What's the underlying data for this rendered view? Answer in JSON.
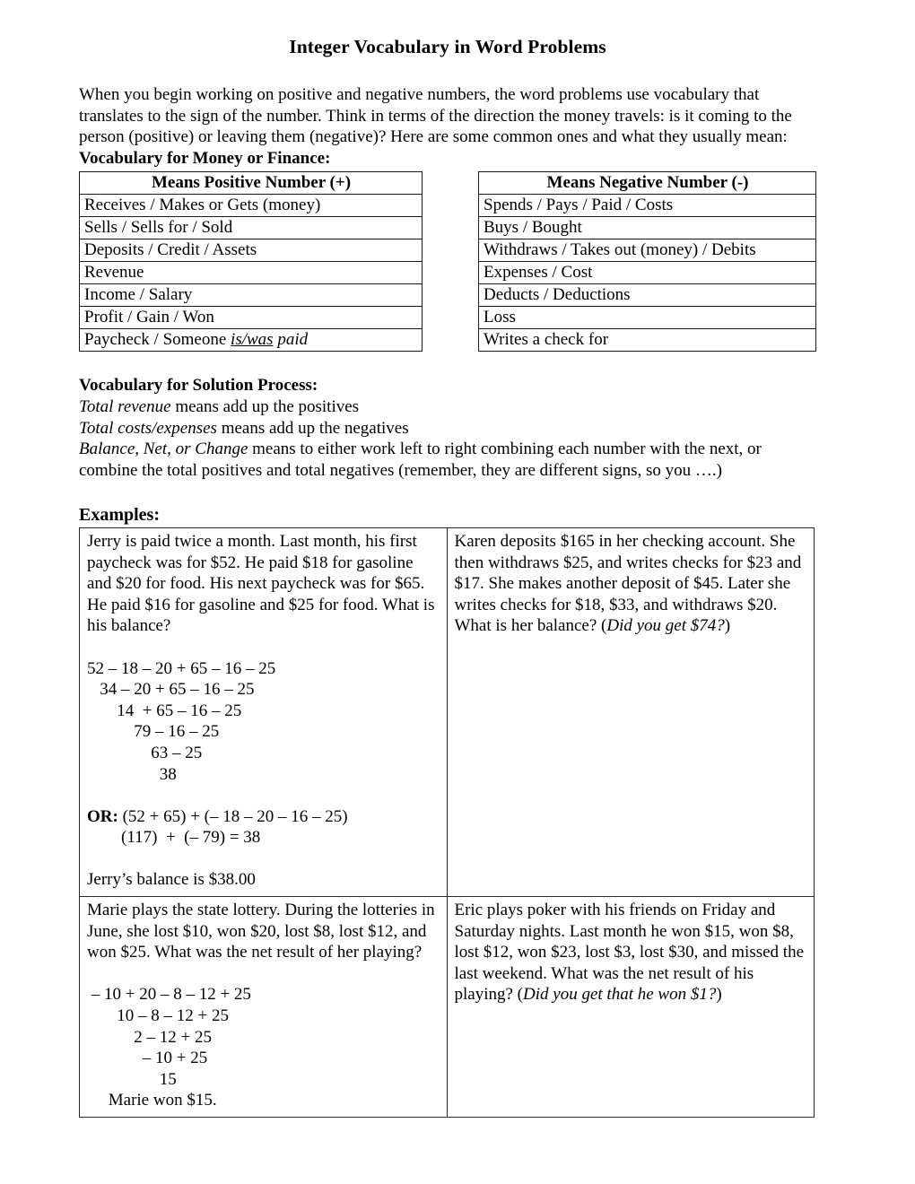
{
  "document": {
    "title": "Integer Vocabulary in Word Problems",
    "intro": "When you begin working on positive and negative numbers, the word problems use vocabulary that translates to the sign of the number.  Think in terms of the direction the money travels: is it coming to the person (positive) or leaving them (negative)?  Here are some common ones and what they usually mean:"
  },
  "money_vocab": {
    "heading": "Vocabulary for Money or Finance:",
    "positive_header": "Means Positive Number (+)",
    "negative_header": "Means Negative Number (-)",
    "positive_rows": [
      "Receives / Makes or Gets (money)",
      "Sells / Sells for / Sold",
      "Deposits / Credit / Assets",
      "Revenue",
      "Income / Salary",
      "Profit / Gain / Won",
      "Paycheck / Someone is/was paid"
    ],
    "positive_row_last": {
      "plain": "Paycheck / Someone ",
      "italic_underline": "is/was",
      "italic": " paid"
    },
    "negative_rows": [
      "Spends / Pays / Paid / Costs",
      "Buys / Bought",
      "Withdraws / Takes out (money) / Debits",
      "Expenses / Cost",
      "Deducts / Deductions",
      "Loss",
      "Writes a check for"
    ]
  },
  "solution_vocab": {
    "heading": "Vocabulary for Solution Process:",
    "line1_italic": "Total revenue",
    "line1_rest": " means add up the positives",
    "line2_italic": "Total costs/expenses",
    "line2_rest": " means add up the negatives",
    "line3_italic": "Balance, Net, or Change",
    "line3_rest": " means to either work left to right combining each number with the next, or combine the total positives and total negatives (remember, they are different signs, so you ….)"
  },
  "examples": {
    "heading": "Examples:",
    "jerry": {
      "problem": "Jerry is paid twice a month. Last month, his first paycheck was for $52.  He paid $18 for gasoline and $20 for food.  His next paycheck was for $65.  He paid $16 for gasoline and $25 for food.  What is his balance?",
      "steps": "52 – 18 – 20 + 65 – 16 – 25\n   34 – 20 + 65 – 16 – 25\n       14  + 65 – 16 – 25\n           79 – 16 – 25\n               63 – 25\n                 38",
      "or_label": "OR:",
      "or_line1": " (52 + 65) + (– 18 – 20 – 16 – 25)",
      "or_line2": "        (117)  +  (– 79) = 38",
      "conclusion": "Jerry’s balance is $38.00"
    },
    "karen": {
      "problem_part1": "Karen deposits $165 in her checking account. She then withdraws $25, and writes checks for $23 and $17.  She makes another deposit of $45. Later she writes checks for $18, $33, and withdraws $20.  What is her balance? (",
      "problem_italic": "Did you get $74?",
      "problem_part2": ")"
    },
    "marie": {
      "problem": "Marie plays the state lottery.  During the lotteries in June, she lost $10, won $20, lost $8, lost $12, and won $25. What was the net result of her playing?",
      "steps": " – 10 + 20 – 8 – 12 + 25\n       10 – 8 – 12 + 25\n           2 – 12 + 25\n             – 10 + 25\n                 15\n     Marie won $15."
    },
    "eric": {
      "problem_part1": "Eric plays poker with his friends on Friday and Saturday nights.  Last month he won $15, won $8, lost $12, won $23, lost $3, lost $30, and missed the last weekend.  What was the net result of his playing? (",
      "problem_italic": "Did you get that he won $1?",
      "problem_part2": ")"
    }
  }
}
